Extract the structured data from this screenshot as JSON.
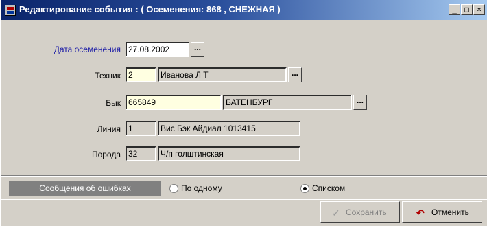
{
  "window": {
    "title": "Редактирование события : ( Осеменения: 868 , СНЕЖНАЯ )",
    "min_glyph": "_",
    "max_glyph": "□",
    "close_glyph": "×"
  },
  "form": {
    "date": {
      "label": "Дата осеменения",
      "value": "27.08.2002",
      "button": "..."
    },
    "technician": {
      "label": "Техник",
      "code": "2",
      "name": "Иванова Л Т",
      "button": "..."
    },
    "bull": {
      "label": "Бык",
      "code": "665849",
      "name": "БАТЕНБУРГ",
      "button": "..."
    },
    "line": {
      "label": "Линия",
      "code": "1",
      "name": "Вис Бэк Айдиал 1013415"
    },
    "breed": {
      "label": "Порода",
      "code": "32",
      "name": "Ч/п голштинская"
    }
  },
  "errors": {
    "label": "Сообщения об ошибках",
    "options": [
      {
        "label": "По одному",
        "selected": false
      },
      {
        "label": "Списком",
        "selected": true
      }
    ]
  },
  "footer": {
    "save": {
      "label": "Сохранить",
      "icon": "check-icon",
      "enabled": false
    },
    "cancel": {
      "label": "Отменить",
      "icon": "undo-arrow-icon"
    }
  },
  "colors": {
    "title_bar": "#0a246a",
    "date_label": "#1a1aa6",
    "editable_field": "#ffffe1",
    "error_panel": "#808080",
    "cancel_icon": "#b00000"
  }
}
